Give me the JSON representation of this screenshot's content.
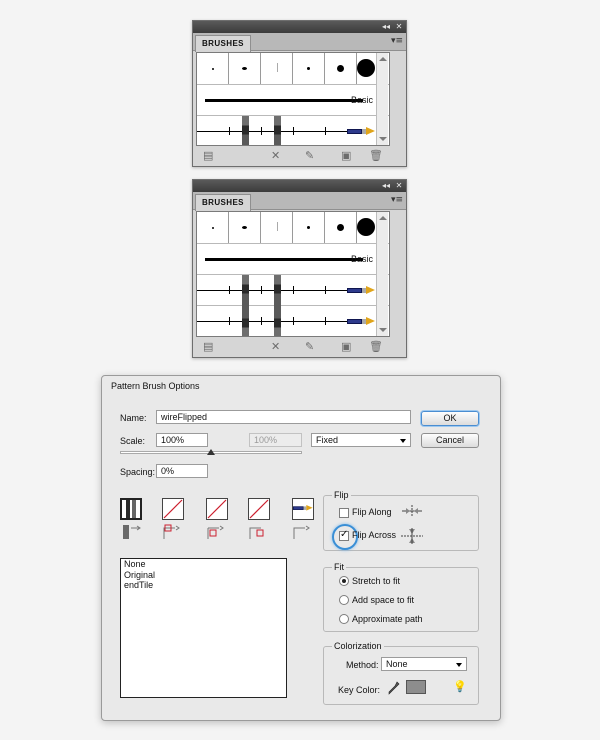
{
  "panels": [
    {
      "tab_label": "BRUSHES",
      "collapse_glyph": "◂◂",
      "close_glyph": "✕",
      "menu_glyph": "▾≡",
      "calligraphic_sizes": [
        "tiny",
        "small-oval",
        "hair",
        "small",
        "medium",
        "large"
      ],
      "basic_label": "Basic",
      "pattern_rows": 1
    },
    {
      "tab_label": "BRUSHES",
      "collapse_glyph": "◂◂",
      "close_glyph": "✕",
      "menu_glyph": "▾≡",
      "calligraphic_sizes": [
        "tiny",
        "small-oval",
        "hair",
        "small",
        "medium",
        "large"
      ],
      "basic_label": "Basic",
      "pattern_rows": 2
    }
  ],
  "panel_bottom_icons": [
    "brush-libraries-menu-icon",
    "remove-brush-stroke-icon",
    "options-of-selected-object-icon",
    "new-brush-icon",
    "delete-brush-icon"
  ],
  "dialog": {
    "title": "Pattern Brush Options",
    "name_label": "Name:",
    "name_value": "wireFlipped",
    "ok_label": "OK",
    "cancel_label": "Cancel",
    "scale_label": "Scale:",
    "scale_value": "100%",
    "scale_max_value": "100%",
    "scale_mode": "Fixed",
    "spacing_label": "Spacing:",
    "spacing_value": "0%",
    "tiles": [
      "side",
      "outer-corner",
      "inner-corner",
      "start",
      "end"
    ],
    "tile_list": [
      "None",
      "Original",
      "endTile"
    ],
    "flip": {
      "legend": "Flip",
      "flip_along_label": "Flip Along",
      "flip_along_checked": false,
      "flip_across_label": "Flip Across",
      "flip_across_checked": true
    },
    "fit": {
      "legend": "Fit",
      "options": [
        "Stretch to fit",
        "Add space to fit",
        "Approximate path"
      ],
      "selected": "Stretch to fit"
    },
    "colorization": {
      "legend": "Colorization",
      "method_label": "Method:",
      "method_value": "None",
      "key_color_label": "Key Color:",
      "key_color": "#8d8d8d"
    }
  }
}
